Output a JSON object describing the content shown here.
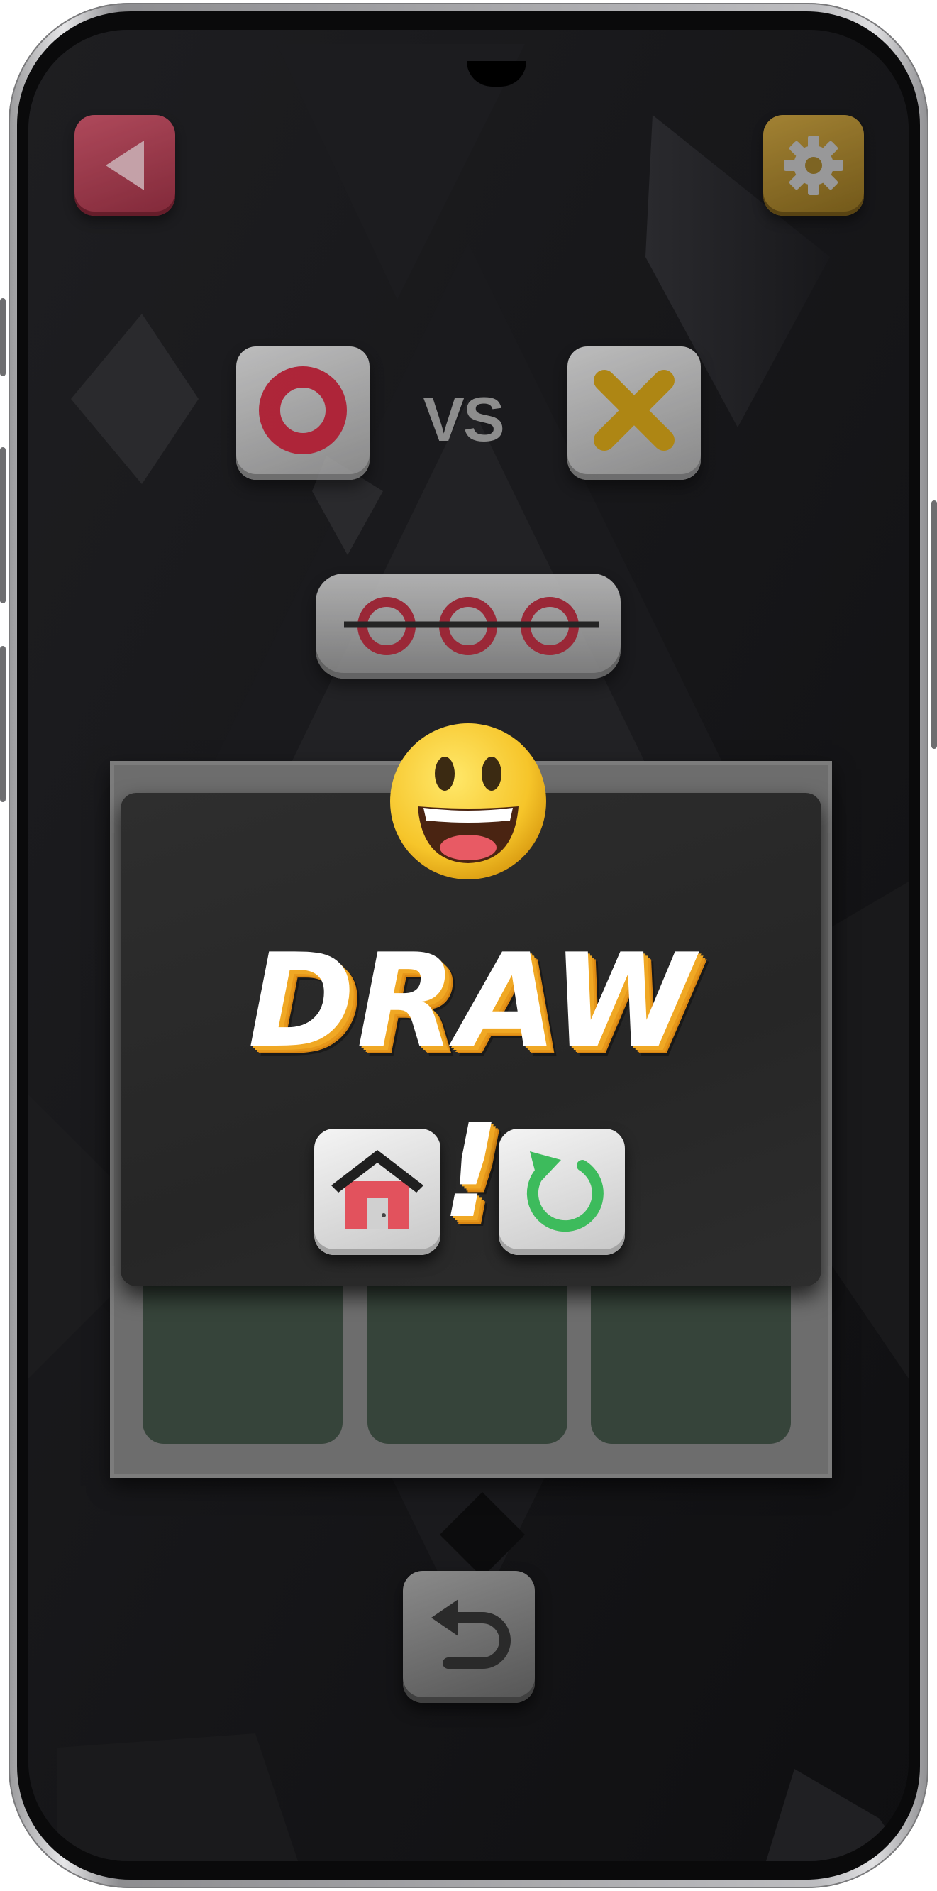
{
  "header": {
    "back_icon": "back-triangle-icon",
    "settings_icon": "gear-icon"
  },
  "players": {
    "left_symbol": "O",
    "vs_label": "VS",
    "right_symbol": "X",
    "colors": {
      "o": "#c8283f",
      "x": "#c99a14"
    }
  },
  "winning_line": {
    "symbols": [
      "O",
      "O",
      "O"
    ]
  },
  "result_dialog": {
    "title": "DRAW !",
    "emoji": "grinning-face-icon",
    "home_icon": "home-icon",
    "restart_icon": "restart-icon",
    "accent": "#f0a824"
  },
  "board": {
    "cells": [
      "",
      "",
      ""
    ]
  },
  "footer": {
    "undo_icon": "undo-icon"
  }
}
